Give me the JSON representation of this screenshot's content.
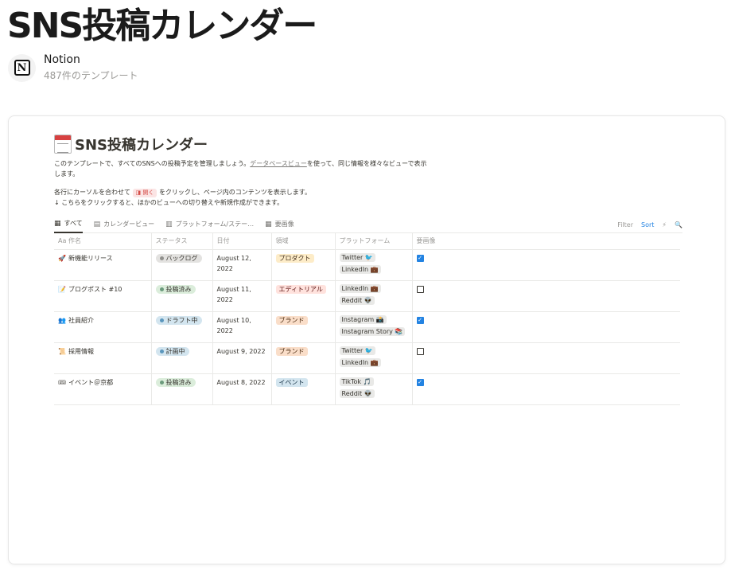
{
  "header": {
    "title": "SNS投稿カレンダー",
    "creator_name": "Notion",
    "creator_sub": "487件のテンプレート",
    "logo_letter": "N"
  },
  "doc": {
    "title": "SNS投稿カレンダー",
    "desc_a": "このテンプレートで、すべてのSNSへの投稿予定を管理しましょう。",
    "desc_link": "データベースビュー",
    "desc_b": "を使って、同じ情報を様々なビューで表示します。",
    "line2_a": "各行にカーソルを合わせて",
    "open_label": "開く",
    "line2_b": "をクリックし、ページ内のコンテンツを表示します。",
    "line3": "↓ こちらをクリックすると、ほかのビューへの切り替えや新規作成ができます。"
  },
  "tabs": [
    {
      "label": "すべて",
      "icon": "table-icon"
    },
    {
      "label": "カレンダービュー",
      "icon": "calendar-icon"
    },
    {
      "label": "プラットフォーム/ステー…",
      "icon": "board-icon"
    },
    {
      "label": "要画像",
      "icon": "table-icon"
    }
  ],
  "tools": {
    "filter": "Filter",
    "sort": "Sort",
    "lightning": "⚡",
    "search": "🔍"
  },
  "columns": [
    "Aa 作名",
    "ステータス",
    "日付",
    "領域",
    "プラットフォーム",
    "要画像"
  ],
  "rows": [
    {
      "icon": "🚀",
      "name": "新機能リリース",
      "status": "バックログ",
      "date": "August 12, 2022",
      "area": "プロダクト",
      "platforms": [
        "Twitter 🐦",
        "LinkedIn 💼"
      ],
      "checked": true
    },
    {
      "icon": "📝",
      "name": "ブログポスト #10",
      "status": "投稿済み",
      "date": "August 11, 2022",
      "area": "エディトリアル",
      "platforms": [
        "LinkedIn 💼",
        "Reddit 👽"
      ],
      "checked": false
    },
    {
      "icon": "👥",
      "name": "社員紹介",
      "status": "ドラフト中",
      "date": "August 10, 2022",
      "area": "ブランド",
      "platforms": [
        "Instagram 📸",
        "Instagram Story 📚"
      ],
      "checked": true
    },
    {
      "icon": "📜",
      "name": "採用情報",
      "status": "計画中",
      "date": "August 9, 2022",
      "area": "ブランド",
      "platforms": [
        "Twitter 🐦",
        "LinkedIn 💼"
      ],
      "checked": false
    },
    {
      "icon": "🎟",
      "name": "イベント＠京都",
      "status": "投稿済み",
      "date": "August 8, 2022",
      "area": "イベント",
      "platforms": [
        "TikTok 🎵",
        "Reddit 👽"
      ],
      "checked": true
    }
  ],
  "colors": {
    "status": {
      "バックログ": [
        "#e3e2e0",
        "#91918e"
      ],
      "投稿済み": [
        "#dbeddb",
        "#6c9b7d"
      ],
      "ドラフト中": [
        "#d3e5ef",
        "#5b97bd"
      ],
      "計画中": [
        "#d3e5ef",
        "#5b97bd"
      ]
    },
    "area": {
      "プロダクト": [
        "#fdecc8",
        "#402c1b"
      ],
      "エディトリアル": [
        "#ffe2dd",
        "#5d1715"
      ],
      "ブランド": [
        "#fadec9",
        "#49290e"
      ],
      "イベント": [
        "#d3e5ef",
        "#183347"
      ]
    }
  }
}
